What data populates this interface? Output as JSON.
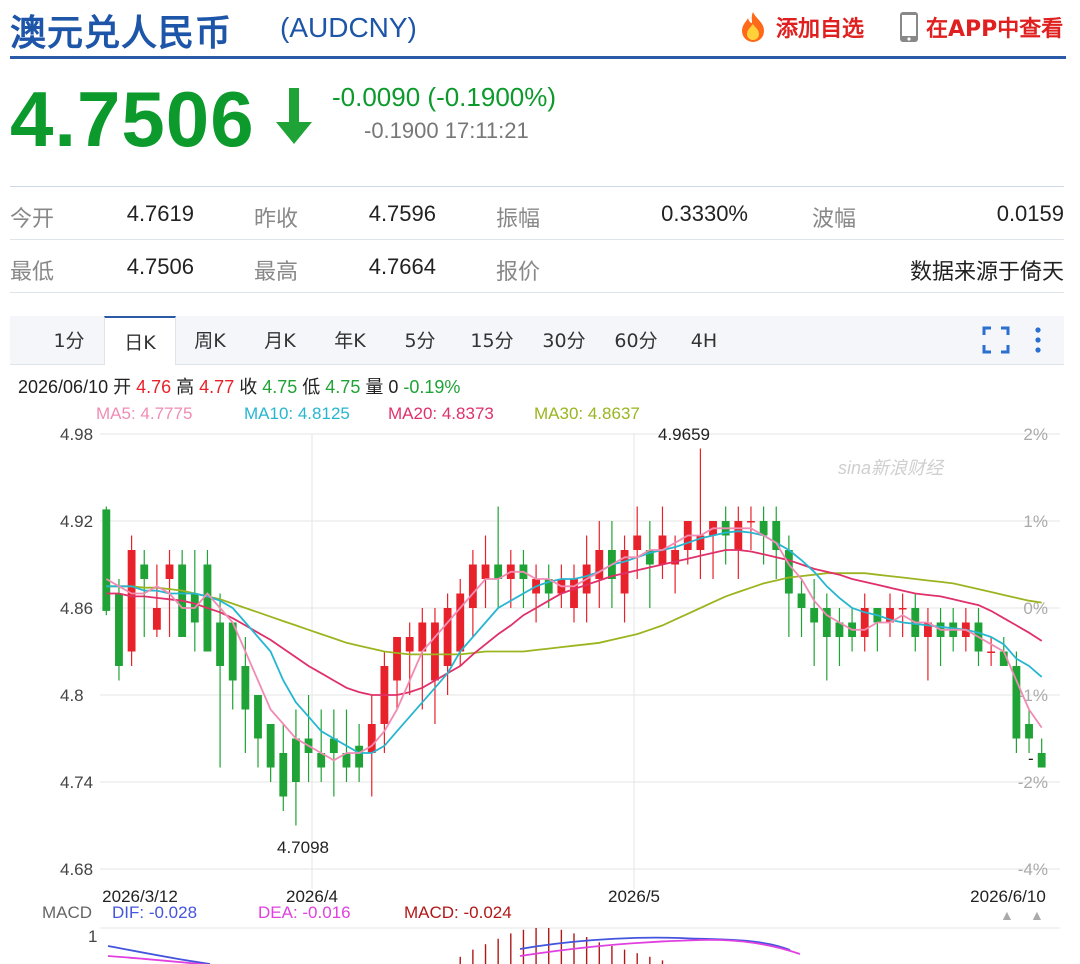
{
  "header": {
    "title": "澳元兑人民币",
    "symbol": "(AUDCNY)",
    "add_watch": "添加自选",
    "open_app": "在APP中查看"
  },
  "quote": {
    "price": "4.7506",
    "change": "-0.0090 (-0.1900%)",
    "sub": "-0.1900 17:11:21"
  },
  "stats": [
    [
      {
        "label": "今开",
        "value": "4.7619"
      },
      {
        "label": "昨收",
        "value": "4.7596"
      },
      {
        "label": "振幅",
        "value": "0.3330%"
      },
      {
        "label": "波幅",
        "value": "0.0159"
      }
    ],
    [
      {
        "label": "最低",
        "value": "4.7506"
      },
      {
        "label": "最高",
        "value": "4.7664"
      },
      {
        "label": "报价",
        "value": ""
      },
      {
        "label": "",
        "value": "数据来源于倚天"
      }
    ]
  ],
  "tabs": [
    "1分",
    "日K",
    "周K",
    "月K",
    "年K",
    "5分",
    "15分",
    "30分",
    "60分",
    "4H"
  ],
  "active_tab": "日K",
  "info": {
    "date": "2026/06/10",
    "open_l": "开",
    "open": "4.76",
    "high_l": "高",
    "high": "4.77",
    "close_l": "收",
    "close": "4.75",
    "low_l": "低",
    "low": "4.75",
    "vol_l": "量",
    "vol": "0",
    "pct": "-0.19%"
  },
  "ma": [
    {
      "label": "MA5: 4.7775",
      "color": "#f08cb4"
    },
    {
      "label": "MA10: 4.8125",
      "color": "#26b6d0"
    },
    {
      "label": "MA20: 4.8373",
      "color": "#e0306a"
    },
    {
      "label": "MA30: 4.8637",
      "color": "#9ab520"
    }
  ],
  "macd": {
    "title": "MACD",
    "dif": "DIF: -0.028",
    "dea": "DEA: -0.016",
    "macd": "MACD: -0.024",
    "ytick": "1"
  },
  "watermark": "sina新浪财经",
  "colors": {
    "up": "#e8222a",
    "down": "#1fa336",
    "dif": "#4455dd",
    "dea": "#e040e0",
    "macd_bar": "#b01818"
  },
  "chart_data": {
    "type": "candlestick",
    "y_ticks": [
      "4.98",
      "4.92",
      "4.86",
      "4.8",
      "4.74",
      "4.68"
    ],
    "ylim": [
      4.68,
      4.98
    ],
    "pct_ticks": [
      "2%",
      "1%",
      "0%",
      "-1%",
      "-2%",
      "-4%"
    ],
    "x_ticks": [
      "2026/3/12",
      "2026/4",
      "2026/5",
      "2026/6/10"
    ],
    "max_label": "4.9659",
    "min_label": "4.7098",
    "last_label": "-",
    "candles": [
      [
        4.928,
        4.858,
        4.93,
        4.855
      ],
      [
        4.87,
        4.82,
        4.88,
        4.81
      ],
      [
        4.83,
        4.9,
        4.91,
        4.82
      ],
      [
        4.89,
        4.88,
        4.9,
        4.84
      ],
      [
        4.845,
        4.86,
        4.89,
        4.84
      ],
      [
        4.88,
        4.89,
        4.9,
        4.84
      ],
      [
        4.89,
        4.84,
        4.9,
        4.84
      ],
      [
        4.87,
        4.85,
        4.9,
        4.83
      ],
      [
        4.89,
        4.83,
        4.9,
        4.83
      ],
      [
        4.85,
        4.82,
        4.87,
        4.75
      ],
      [
        4.85,
        4.81,
        4.84,
        4.79
      ],
      [
        4.82,
        4.79,
        4.84,
        4.76
      ],
      [
        4.8,
        4.77,
        4.8,
        4.75
      ],
      [
        4.78,
        4.75,
        4.76,
        4.74
      ],
      [
        4.76,
        4.73,
        4.78,
        4.72
      ],
      [
        4.77,
        4.74,
        4.79,
        4.71
      ],
      [
        4.77,
        4.76,
        4.8,
        4.74
      ],
      [
        4.76,
        4.75,
        4.79,
        4.74
      ],
      [
        4.77,
        4.76,
        4.79,
        4.73
      ],
      [
        4.76,
        4.75,
        4.79,
        4.74
      ],
      [
        4.765,
        4.75,
        4.78,
        4.74
      ],
      [
        4.76,
        4.78,
        4.8,
        4.73
      ],
      [
        4.78,
        4.82,
        4.83,
        4.76
      ],
      [
        4.81,
        4.84,
        4.84,
        4.79
      ],
      [
        4.83,
        4.84,
        4.85,
        4.8
      ],
      [
        4.83,
        4.85,
        4.86,
        4.79
      ],
      [
        4.81,
        4.85,
        4.86,
        4.78
      ],
      [
        4.82,
        4.86,
        4.87,
        4.8
      ],
      [
        4.83,
        4.87,
        4.88,
        4.82
      ],
      [
        4.86,
        4.89,
        4.9,
        4.84
      ],
      [
        4.88,
        4.89,
        4.91,
        4.86
      ],
      [
        4.89,
        4.88,
        4.93,
        4.86
      ],
      [
        4.88,
        4.89,
        4.9,
        4.86
      ],
      [
        4.89,
        4.88,
        4.9,
        4.86
      ],
      [
        4.87,
        4.88,
        4.89,
        4.85
      ],
      [
        4.88,
        4.87,
        4.89,
        4.86
      ],
      [
        4.87,
        4.88,
        4.89,
        4.86
      ],
      [
        4.86,
        4.88,
        4.89,
        4.85
      ],
      [
        4.87,
        4.89,
        4.91,
        4.85
      ],
      [
        4.88,
        4.9,
        4.92,
        4.86
      ],
      [
        4.9,
        4.88,
        4.92,
        4.86
      ],
      [
        4.87,
        4.9,
        4.91,
        4.85
      ],
      [
        4.9,
        4.91,
        4.93,
        4.88
      ],
      [
        4.9,
        4.89,
        4.92,
        4.86
      ],
      [
        4.89,
        4.91,
        4.93,
        4.88
      ],
      [
        4.89,
        4.9,
        4.91,
        4.87
      ],
      [
        4.9,
        4.92,
        4.92,
        4.89
      ],
      [
        4.9,
        4.91,
        4.97,
        4.88
      ],
      [
        4.91,
        4.92,
        4.92,
        4.88
      ],
      [
        4.92,
        4.91,
        4.93,
        4.89
      ],
      [
        4.9,
        4.92,
        4.93,
        4.88
      ],
      [
        4.92,
        4.92,
        4.93,
        4.9
      ],
      [
        4.92,
        4.91,
        4.93,
        4.89
      ],
      [
        4.92,
        4.9,
        4.93,
        4.88
      ],
      [
        4.9,
        4.87,
        4.91,
        4.84
      ],
      [
        4.87,
        4.86,
        4.88,
        4.84
      ],
      [
        4.86,
        4.85,
        4.88,
        4.82
      ],
      [
        4.86,
        4.84,
        4.87,
        4.81
      ],
      [
        4.85,
        4.84,
        4.86,
        4.82
      ],
      [
        4.85,
        4.84,
        4.86,
        4.83
      ],
      [
        4.84,
        4.86,
        4.87,
        4.83
      ],
      [
        4.86,
        4.85,
        4.86,
        4.83
      ],
      [
        4.85,
        4.86,
        4.87,
        4.84
      ],
      [
        4.86,
        4.86,
        4.87,
        4.84
      ],
      [
        4.86,
        4.84,
        4.87,
        4.83
      ],
      [
        4.84,
        4.85,
        4.86,
        4.81
      ],
      [
        4.85,
        4.84,
        4.86,
        4.82
      ],
      [
        4.85,
        4.84,
        4.86,
        4.83
      ],
      [
        4.84,
        4.85,
        4.86,
        4.83
      ],
      [
        4.85,
        4.83,
        4.86,
        4.82
      ],
      [
        4.83,
        4.83,
        4.84,
        4.82
      ],
      [
        4.83,
        4.82,
        4.84,
        4.82
      ],
      [
        4.82,
        4.77,
        4.83,
        4.76
      ],
      [
        4.78,
        4.77,
        4.79,
        4.76
      ],
      [
        4.76,
        4.75,
        4.77,
        4.75
      ]
    ],
    "ma5": [
      4.88,
      4.875,
      4.87,
      4.87,
      4.875,
      4.87,
      4.86,
      4.86,
      4.87,
      4.86,
      4.85,
      4.83,
      4.81,
      4.79,
      4.78,
      4.77,
      4.765,
      4.76,
      4.755,
      4.76,
      4.76,
      4.765,
      4.775,
      4.79,
      4.81,
      4.83,
      4.84,
      4.85,
      4.86,
      4.87,
      4.88,
      4.88,
      4.885,
      4.885,
      4.88,
      4.88,
      4.875,
      4.875,
      4.88,
      4.885,
      4.89,
      4.895,
      4.895,
      4.9,
      4.9,
      4.905,
      4.91,
      4.91,
      4.915,
      4.915,
      4.915,
      4.915,
      4.91,
      4.905,
      4.89,
      4.88,
      4.865,
      4.855,
      4.85,
      4.845,
      4.845,
      4.85,
      4.85,
      4.855,
      4.85,
      4.85,
      4.845,
      4.845,
      4.845,
      4.84,
      4.835,
      4.83,
      4.81,
      4.79,
      4.7775
    ],
    "ma10": [
      4.875,
      4.875,
      4.875,
      4.872,
      4.872,
      4.87,
      4.87,
      4.87,
      4.868,
      4.865,
      4.86,
      4.85,
      4.84,
      4.83,
      4.81,
      4.795,
      4.785,
      4.775,
      4.77,
      4.765,
      4.76,
      4.76,
      4.765,
      4.775,
      4.785,
      4.795,
      4.805,
      4.815,
      4.83,
      4.84,
      4.85,
      4.86,
      4.865,
      4.87,
      4.875,
      4.878,
      4.88,
      4.88,
      4.882,
      4.885,
      4.89,
      4.892,
      4.895,
      4.898,
      4.9,
      4.902,
      4.905,
      4.908,
      4.91,
      4.912,
      4.913,
      4.912,
      4.91,
      4.905,
      4.9,
      4.893,
      4.885,
      4.875,
      4.867,
      4.86,
      4.857,
      4.855,
      4.852,
      4.85,
      4.849,
      4.848,
      4.847,
      4.846,
      4.845,
      4.843,
      4.84,
      4.835,
      4.825,
      4.82,
      4.8125
    ],
    "ma20": [
      4.87,
      4.87,
      4.868,
      4.868,
      4.867,
      4.866,
      4.865,
      4.863,
      4.86,
      4.857,
      4.853,
      4.848,
      4.843,
      4.838,
      4.832,
      4.826,
      4.82,
      4.815,
      4.81,
      4.805,
      4.802,
      4.8,
      4.8,
      4.8,
      4.802,
      4.805,
      4.81,
      4.815,
      4.82,
      4.828,
      4.835,
      4.842,
      4.848,
      4.855,
      4.86,
      4.865,
      4.87,
      4.873,
      4.876,
      4.879,
      4.882,
      4.884,
      4.886,
      4.888,
      4.89,
      4.892,
      4.894,
      4.896,
      4.898,
      4.9,
      4.9,
      4.899,
      4.897,
      4.895,
      4.893,
      4.89,
      4.887,
      4.885,
      4.883,
      4.88,
      4.878,
      4.876,
      4.874,
      4.872,
      4.87,
      4.869,
      4.868,
      4.866,
      4.864,
      4.862,
      4.858,
      4.853,
      4.848,
      4.843,
      4.8373
    ],
    "ma30": [
      4.875,
      4.875,
      4.875,
      4.874,
      4.874,
      4.873,
      4.872,
      4.87,
      4.868,
      4.866,
      4.863,
      4.86,
      4.857,
      4.854,
      4.851,
      4.848,
      4.845,
      4.842,
      4.839,
      4.836,
      4.834,
      4.832,
      4.83,
      4.829,
      4.828,
      4.828,
      4.828,
      4.828,
      4.828,
      4.829,
      4.83,
      4.83,
      4.83,
      4.83,
      4.831,
      4.832,
      4.833,
      4.834,
      4.835,
      4.836,
      4.838,
      4.84,
      4.842,
      4.845,
      4.848,
      4.852,
      4.856,
      4.86,
      4.864,
      4.868,
      4.871,
      4.874,
      4.877,
      4.879,
      4.881,
      4.882,
      4.883,
      4.884,
      4.884,
      4.884,
      4.884,
      4.883,
      4.882,
      4.881,
      4.88,
      4.879,
      4.878,
      4.877,
      4.875,
      4.873,
      4.871,
      4.869,
      4.867,
      4.865,
      4.8637
    ],
    "macd_hist": [
      0,
      0,
      0,
      0,
      0,
      0,
      0,
      0,
      0,
      0,
      0,
      0,
      0,
      0,
      0,
      0,
      0,
      0,
      0,
      0,
      0,
      0,
      0,
      0,
      0,
      0,
      0,
      0,
      0.2,
      0.4,
      0.55,
      0.7,
      0.85,
      0.95,
      1.0,
      1.0,
      0.95,
      0.85,
      0.75,
      0.6,
      0.5,
      0.4,
      0.3,
      0.2,
      0.1,
      0,
      0,
      0,
      0,
      0,
      0,
      0,
      0,
      0,
      0,
      0,
      0,
      0,
      0,
      0,
      0,
      0,
      0,
      0,
      0,
      0,
      0,
      0,
      0,
      0,
      0,
      0,
      0,
      0,
      0
    ]
  }
}
